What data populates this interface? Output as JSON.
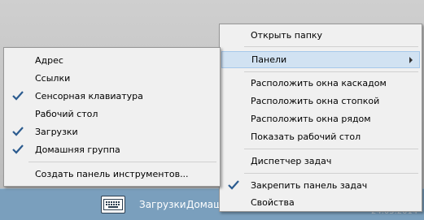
{
  "taskbar": {
    "keyboard_icon": "keyboard-icon",
    "toolbars": [
      "Загрузки",
      "Домаш"
    ],
    "clock": "24.05.2014"
  },
  "main_menu": {
    "items": [
      {
        "label": "Открыть папку",
        "checked": false,
        "submenu": false
      },
      {
        "label": "Панели",
        "checked": false,
        "submenu": true,
        "active": true
      },
      {
        "label": "Расположить окна каскадом",
        "checked": false,
        "submenu": false
      },
      {
        "label": "Расположить окна стопкой",
        "checked": false,
        "submenu": false
      },
      {
        "label": "Расположить окна рядом",
        "checked": false,
        "submenu": false
      },
      {
        "label": "Показать рабочий стол",
        "checked": false,
        "submenu": false
      },
      {
        "label": "Диспетчер задач",
        "checked": false,
        "submenu": false
      },
      {
        "label": "Закрепить панель задач",
        "checked": true,
        "submenu": false
      },
      {
        "label": "Свойства",
        "checked": false,
        "submenu": false
      }
    ]
  },
  "toolbars_menu": {
    "items": [
      {
        "label": "Адрес",
        "checked": false
      },
      {
        "label": "Ссылки",
        "checked": false
      },
      {
        "label": "Сенсорная клавиатура",
        "checked": true
      },
      {
        "label": "Рабочий стол",
        "checked": false
      },
      {
        "label": "Загрузки",
        "checked": true
      },
      {
        "label": "Домашняя группа",
        "checked": true
      },
      {
        "label": "Создать панель инструментов...",
        "checked": false
      }
    ]
  },
  "colors": {
    "taskbar": "#7a9fbd",
    "menu_bg": "#f0f0f0",
    "highlight": "#d1e2f2",
    "check": "#2b5b8f"
  }
}
